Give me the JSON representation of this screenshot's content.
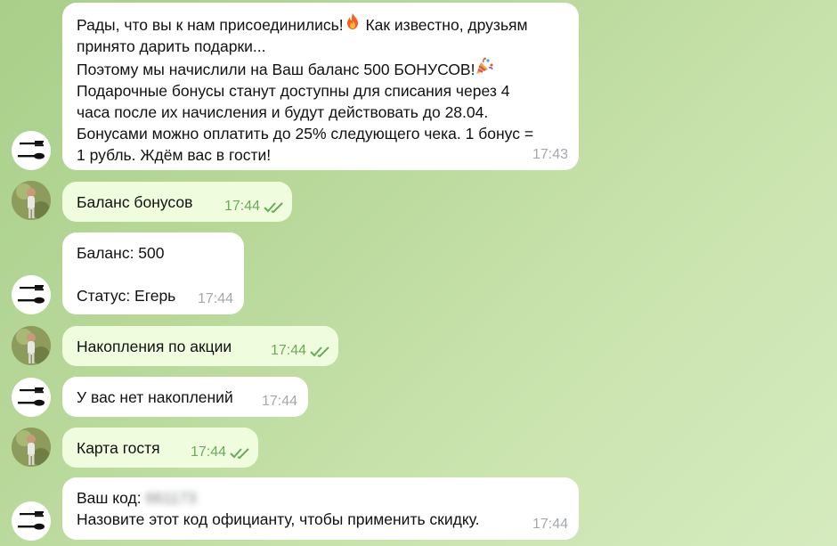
{
  "messages": [
    {
      "sender": "bot",
      "lines": [
        "Рады, что вы к нам присоединились!",
        "Как известно, друзьям",
        "принято дарить подарки...",
        "Поэтому мы начислили на Ваш баланс 500 БОНУСОВ!",
        "Подарочные бонусы станут доступны для списания через 4",
        "часа после их начисления и будут действовать до 28.04.",
        "Бонусами можно оплатить до 25% следующего чека. 1 бонус =",
        "1 рубль. Ждём вас в гости!"
      ],
      "time": "17:43"
    },
    {
      "sender": "user",
      "text": "Баланс бонусов",
      "time": "17:44",
      "read": true
    },
    {
      "sender": "bot",
      "text": "Баланс: 500\n\nСтатус: Егерь",
      "time": "17:44"
    },
    {
      "sender": "user",
      "text": "Накопления по акции",
      "time": "17:44",
      "read": true
    },
    {
      "sender": "bot",
      "text": "У вас нет накоплений",
      "time": "17:44"
    },
    {
      "sender": "user",
      "text": "Карта гостя",
      "time": "17:44",
      "read": true
    },
    {
      "sender": "bot",
      "code_label": "Ваш код:",
      "code_value": "661173",
      "text": "Назовите этот код официанту, чтобы применить скидку.",
      "time": "17:44"
    }
  ],
  "icons": {
    "fire": "fire-emoji-icon",
    "party": "party-popper-emoji-icon",
    "bot_avatar": "cutlery-logo-icon",
    "user_avatar": "user-photo-avatar",
    "read": "double-check-icon"
  },
  "colors": {
    "incoming_bubble": "#ffffff",
    "outgoing_bubble": "#effdde",
    "outgoing_time": "#6aaa5a",
    "incoming_time": "#a3a8ad"
  }
}
